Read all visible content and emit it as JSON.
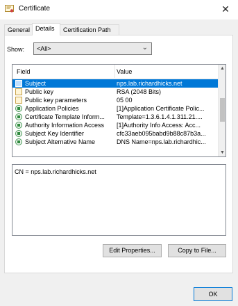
{
  "window": {
    "title": "Certificate",
    "close_glyph": "✕"
  },
  "tabs": [
    {
      "label": "General",
      "active": false
    },
    {
      "label": "Details",
      "active": true
    },
    {
      "label": "Certification Path",
      "active": false
    }
  ],
  "show": {
    "label": "Show:",
    "value": "<All>"
  },
  "list": {
    "headers": {
      "field": "Field",
      "value": "Value"
    },
    "rows": [
      {
        "icon": "doc-icon",
        "field": "Subject",
        "value": "nps.lab.richardhicks.net",
        "selected": true
      },
      {
        "icon": "doc-icon",
        "field": "Public key",
        "value": "RSA (2048 Bits)"
      },
      {
        "icon": "doc-icon",
        "field": "Public key parameters",
        "value": "05 00"
      },
      {
        "icon": "extension-icon",
        "field": "Application Policies",
        "value": "[1]Application Certificate Polic..."
      },
      {
        "icon": "extension-icon",
        "field": "Certificate Template Inform...",
        "value": "Template=1.3.6.1.4.1.311.21...."
      },
      {
        "icon": "extension-icon",
        "field": "Authority Information Access",
        "value": "[1]Authority Info Access: Acc..."
      },
      {
        "icon": "extension-icon",
        "field": "Subject Key Identifier",
        "value": "cfc33aeb095babd9b88c87b3a..."
      },
      {
        "icon": "extension-icon",
        "field": "Subject Alternative Name",
        "value": "DNS Name=nps.lab.richardhic..."
      }
    ]
  },
  "detail": {
    "text": "CN = nps.lab.richardhicks.net"
  },
  "buttons": {
    "edit": "Edit Properties...",
    "copy": "Copy to File...",
    "ok": "OK"
  },
  "colors": {
    "selection": "#0078d7",
    "background": "#f0f0f0"
  }
}
